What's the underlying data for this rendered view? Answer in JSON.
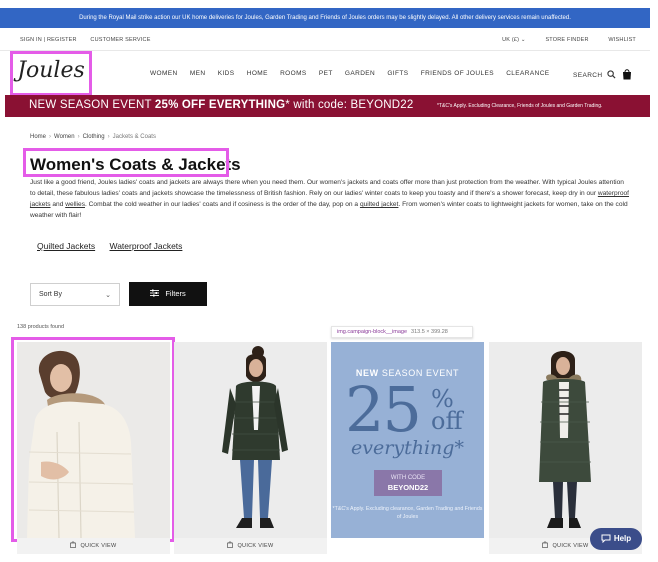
{
  "notice_bar": "During the Royal Mail strike action our UK home deliveries for Joules, Garden Trading and Friends of Joules orders may be slightly delayed. All other delivery services remain unaffected.",
  "utility": {
    "sign_in": "SIGN IN | REGISTER",
    "customer_service": "CUSTOMER SERVICE",
    "currency": "UK (£)",
    "store_finder": "STORE FINDER",
    "wishlist": "WISHLIST"
  },
  "logo": "Joules",
  "nav": [
    "WOMEN",
    "MEN",
    "KIDS",
    "HOME",
    "ROOMS",
    "PET",
    "GARDEN",
    "GIFTS",
    "FRIENDS OF JOULES",
    "CLEARANCE"
  ],
  "search_label": "SEARCH",
  "promo": {
    "lead": "NEW SEASON EVENT",
    "offer": "25% OFF EVERYTHING",
    "star": "*",
    "code_text": "with code: BEYOND22",
    "terms": "*T&C's Apply. Excluding Clearance, Friends of Joules and Garden Trading."
  },
  "breadcrumb": [
    "Home",
    "Women",
    "Clothing",
    "Jackets & Coats"
  ],
  "page_title": "Women's Coats & Jackets",
  "description": {
    "p1": "Just like a good friend, Joules ladies' coats and jackets are always there when you need them. Our women's jackets and coats offer more than just protection from the weather. With typical Joules attention to detail, these fabulous ladies' coats and jackets showcase the timelessness of British fashion. Rely on our ladies' winter coats to keep you toasty and if there's a shower forecast, keep dry in our ",
    "link1": "waterproof jackets",
    "and": " and ",
    "link2": "wellies",
    "p2": ". Combat the cold weather in our ladies' coats and if cosiness is the order of the day, pop on a ",
    "link3": "quilted jacket",
    "p3": ". From women's winter coats to lightweight jackets for women, take on the cold weather with flair!"
  },
  "sub_categories": [
    "Quilted Jackets",
    "Waterproof Jackets"
  ],
  "sort_label": "Sort By",
  "filters_label": "Filters",
  "products_found": "138 products found",
  "devtools_tip": {
    "selector": "img.campaign-block__image",
    "size": "313.5 × 399.28"
  },
  "quick_view": "QUICK VIEW",
  "campaign": {
    "new": "NEW",
    "season_event": "SEASON EVENT",
    "number": "25",
    "percent": "%",
    "off": "off",
    "everything": "everything",
    "asterisk": "*",
    "with_code": "WITH CODE",
    "code": "BEYOND22",
    "terms": "*T&C's Apply. Excluding clearance, Garden Trading and Friends of Joules"
  },
  "help_label": "Help",
  "colors": {
    "notice_bg": "#3266c4",
    "promo_bg": "#8a1133",
    "highlight": "#e45ce8",
    "campaign_bg": "#97b1d6",
    "campaign_text": "#4c6c9a",
    "help_bg": "#3b4d8a"
  }
}
